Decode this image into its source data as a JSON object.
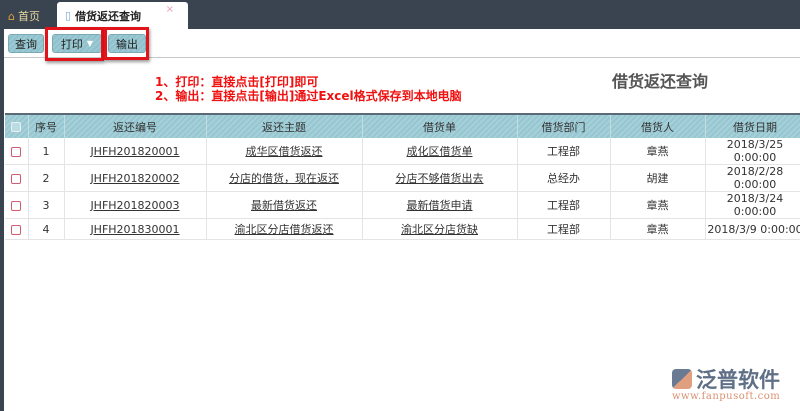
{
  "tabs": {
    "home": "首页",
    "active": "借货返还查询",
    "close": "×"
  },
  "toolbar": {
    "query": "查询",
    "print": "打印",
    "export": "输出"
  },
  "notes": [
    "1、打印：直接点击[打印]即可",
    "2、输出：直接点击[输出]通过Excel格式保存到本地电脑"
  ],
  "page_title": "借货返还查询",
  "table": {
    "headers": [
      "序号",
      "返还编号",
      "返还主题",
      "借货单",
      "借货部门",
      "借货人",
      "借货日期"
    ],
    "rows": [
      {
        "no": "1",
        "code": "JHFH201820001",
        "subject": "成华区借货返还",
        "order": "成化区借货单",
        "dept": "工程部",
        "person": "章燕",
        "date": "2018/3/25 0:00:00"
      },
      {
        "no": "2",
        "code": "JHFH201820002",
        "subject": "分店的借货，现在返还",
        "order": "分店不够借货出去",
        "dept": "总经办",
        "person": "胡建",
        "date": "2018/2/28 0:00:00"
      },
      {
        "no": "3",
        "code": "JHFH201820003",
        "subject": "最新借货返还",
        "order": "最新借货申请",
        "dept": "工程部",
        "person": "章燕",
        "date": "2018/3/24 0:00:00"
      },
      {
        "no": "4",
        "code": "JHFH201830001",
        "subject": "渝北区分店借货返还",
        "order": "渝北区分店货缺",
        "dept": "工程部",
        "person": "章燕",
        "date": "2018/3/9 0:00:00"
      }
    ]
  },
  "logo": {
    "name": "泛普软件",
    "url": "www.fanpusoft.com"
  }
}
